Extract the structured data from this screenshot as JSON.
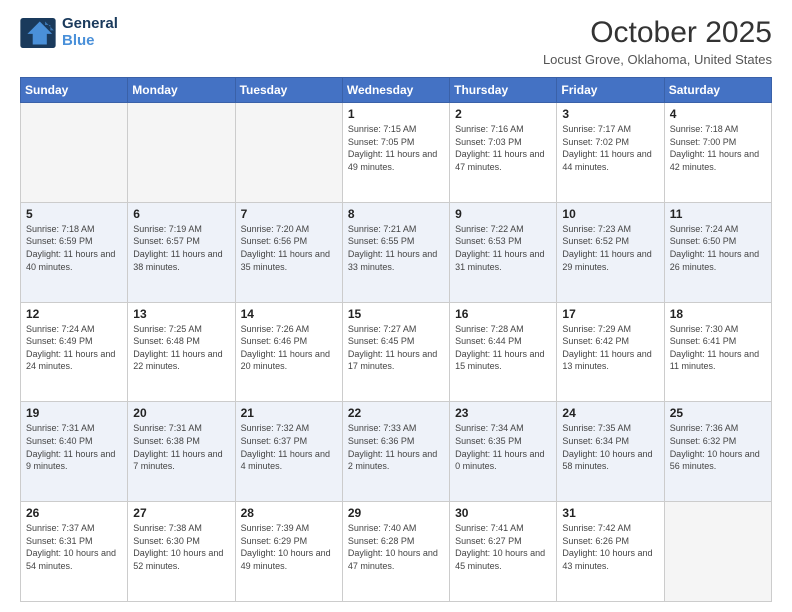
{
  "logo": {
    "line1": "General",
    "line2": "Blue"
  },
  "title": "October 2025",
  "location": "Locust Grove, Oklahoma, United States",
  "days_of_week": [
    "Sunday",
    "Monday",
    "Tuesday",
    "Wednesday",
    "Thursday",
    "Friday",
    "Saturday"
  ],
  "weeks": [
    [
      {
        "day": "",
        "info": ""
      },
      {
        "day": "",
        "info": ""
      },
      {
        "day": "",
        "info": ""
      },
      {
        "day": "1",
        "info": "Sunrise: 7:15 AM\nSunset: 7:05 PM\nDaylight: 11 hours and 49 minutes."
      },
      {
        "day": "2",
        "info": "Sunrise: 7:16 AM\nSunset: 7:03 PM\nDaylight: 11 hours and 47 minutes."
      },
      {
        "day": "3",
        "info": "Sunrise: 7:17 AM\nSunset: 7:02 PM\nDaylight: 11 hours and 44 minutes."
      },
      {
        "day": "4",
        "info": "Sunrise: 7:18 AM\nSunset: 7:00 PM\nDaylight: 11 hours and 42 minutes."
      }
    ],
    [
      {
        "day": "5",
        "info": "Sunrise: 7:18 AM\nSunset: 6:59 PM\nDaylight: 11 hours and 40 minutes."
      },
      {
        "day": "6",
        "info": "Sunrise: 7:19 AM\nSunset: 6:57 PM\nDaylight: 11 hours and 38 minutes."
      },
      {
        "day": "7",
        "info": "Sunrise: 7:20 AM\nSunset: 6:56 PM\nDaylight: 11 hours and 35 minutes."
      },
      {
        "day": "8",
        "info": "Sunrise: 7:21 AM\nSunset: 6:55 PM\nDaylight: 11 hours and 33 minutes."
      },
      {
        "day": "9",
        "info": "Sunrise: 7:22 AM\nSunset: 6:53 PM\nDaylight: 11 hours and 31 minutes."
      },
      {
        "day": "10",
        "info": "Sunrise: 7:23 AM\nSunset: 6:52 PM\nDaylight: 11 hours and 29 minutes."
      },
      {
        "day": "11",
        "info": "Sunrise: 7:24 AM\nSunset: 6:50 PM\nDaylight: 11 hours and 26 minutes."
      }
    ],
    [
      {
        "day": "12",
        "info": "Sunrise: 7:24 AM\nSunset: 6:49 PM\nDaylight: 11 hours and 24 minutes."
      },
      {
        "day": "13",
        "info": "Sunrise: 7:25 AM\nSunset: 6:48 PM\nDaylight: 11 hours and 22 minutes."
      },
      {
        "day": "14",
        "info": "Sunrise: 7:26 AM\nSunset: 6:46 PM\nDaylight: 11 hours and 20 minutes."
      },
      {
        "day": "15",
        "info": "Sunrise: 7:27 AM\nSunset: 6:45 PM\nDaylight: 11 hours and 17 minutes."
      },
      {
        "day": "16",
        "info": "Sunrise: 7:28 AM\nSunset: 6:44 PM\nDaylight: 11 hours and 15 minutes."
      },
      {
        "day": "17",
        "info": "Sunrise: 7:29 AM\nSunset: 6:42 PM\nDaylight: 11 hours and 13 minutes."
      },
      {
        "day": "18",
        "info": "Sunrise: 7:30 AM\nSunset: 6:41 PM\nDaylight: 11 hours and 11 minutes."
      }
    ],
    [
      {
        "day": "19",
        "info": "Sunrise: 7:31 AM\nSunset: 6:40 PM\nDaylight: 11 hours and 9 minutes."
      },
      {
        "day": "20",
        "info": "Sunrise: 7:31 AM\nSunset: 6:38 PM\nDaylight: 11 hours and 7 minutes."
      },
      {
        "day": "21",
        "info": "Sunrise: 7:32 AM\nSunset: 6:37 PM\nDaylight: 11 hours and 4 minutes."
      },
      {
        "day": "22",
        "info": "Sunrise: 7:33 AM\nSunset: 6:36 PM\nDaylight: 11 hours and 2 minutes."
      },
      {
        "day": "23",
        "info": "Sunrise: 7:34 AM\nSunset: 6:35 PM\nDaylight: 11 hours and 0 minutes."
      },
      {
        "day": "24",
        "info": "Sunrise: 7:35 AM\nSunset: 6:34 PM\nDaylight: 10 hours and 58 minutes."
      },
      {
        "day": "25",
        "info": "Sunrise: 7:36 AM\nSunset: 6:32 PM\nDaylight: 10 hours and 56 minutes."
      }
    ],
    [
      {
        "day": "26",
        "info": "Sunrise: 7:37 AM\nSunset: 6:31 PM\nDaylight: 10 hours and 54 minutes."
      },
      {
        "day": "27",
        "info": "Sunrise: 7:38 AM\nSunset: 6:30 PM\nDaylight: 10 hours and 52 minutes."
      },
      {
        "day": "28",
        "info": "Sunrise: 7:39 AM\nSunset: 6:29 PM\nDaylight: 10 hours and 49 minutes."
      },
      {
        "day": "29",
        "info": "Sunrise: 7:40 AM\nSunset: 6:28 PM\nDaylight: 10 hours and 47 minutes."
      },
      {
        "day": "30",
        "info": "Sunrise: 7:41 AM\nSunset: 6:27 PM\nDaylight: 10 hours and 45 minutes."
      },
      {
        "day": "31",
        "info": "Sunrise: 7:42 AM\nSunset: 6:26 PM\nDaylight: 10 hours and 43 minutes."
      },
      {
        "day": "",
        "info": ""
      }
    ]
  ]
}
